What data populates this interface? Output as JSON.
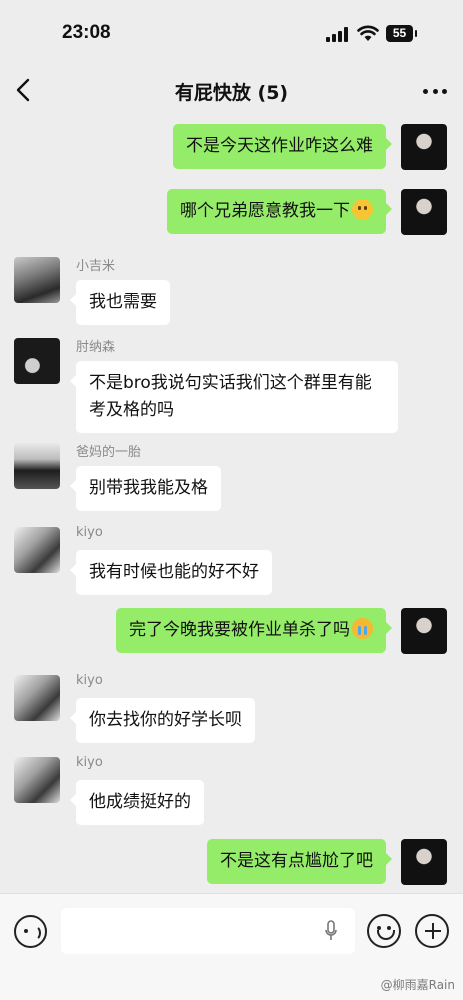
{
  "status_bar": {
    "time": "23:08",
    "battery": "55"
  },
  "header": {
    "title": "有屁快放 (5)"
  },
  "messages": [
    {
      "dir": "out",
      "text": "不是今天这作业咋这么难",
      "avatar": "me"
    },
    {
      "dir": "out",
      "text": "哪个兄弟愿意教我一下",
      "emoji": "blush",
      "avatar": "me"
    },
    {
      "dir": "in",
      "sender": "小吉米",
      "text": "我也需要",
      "avatar": "a1"
    },
    {
      "dir": "in",
      "sender": "肘纳森",
      "text": "不是bro我说句实话我们这个群里有能考及格的吗",
      "avatar": "a2"
    },
    {
      "dir": "in",
      "sender": "爸妈的一胎",
      "text": "别带我我能及格",
      "avatar": "a3"
    },
    {
      "dir": "in",
      "sender": "kiyo",
      "text": "我有时候也能的好不好",
      "avatar": "a4"
    },
    {
      "dir": "out",
      "text": "完了今晚我要被作业单杀了吗",
      "emoji": "cry",
      "avatar": "me"
    },
    {
      "dir": "in",
      "sender": "kiyo",
      "text": "你去找你的好学长呗",
      "avatar": "a4"
    },
    {
      "dir": "in",
      "sender": "kiyo",
      "text": "他成绩挺好的",
      "avatar": "a4"
    },
    {
      "dir": "out",
      "text": "不是这有点尴尬了吧",
      "avatar": "me"
    }
  ],
  "watermark": "@柳雨嘉Rain",
  "colors": {
    "outgoing_bubble": "#95ec69",
    "incoming_bubble": "#ffffff",
    "background": "#ededed"
  }
}
